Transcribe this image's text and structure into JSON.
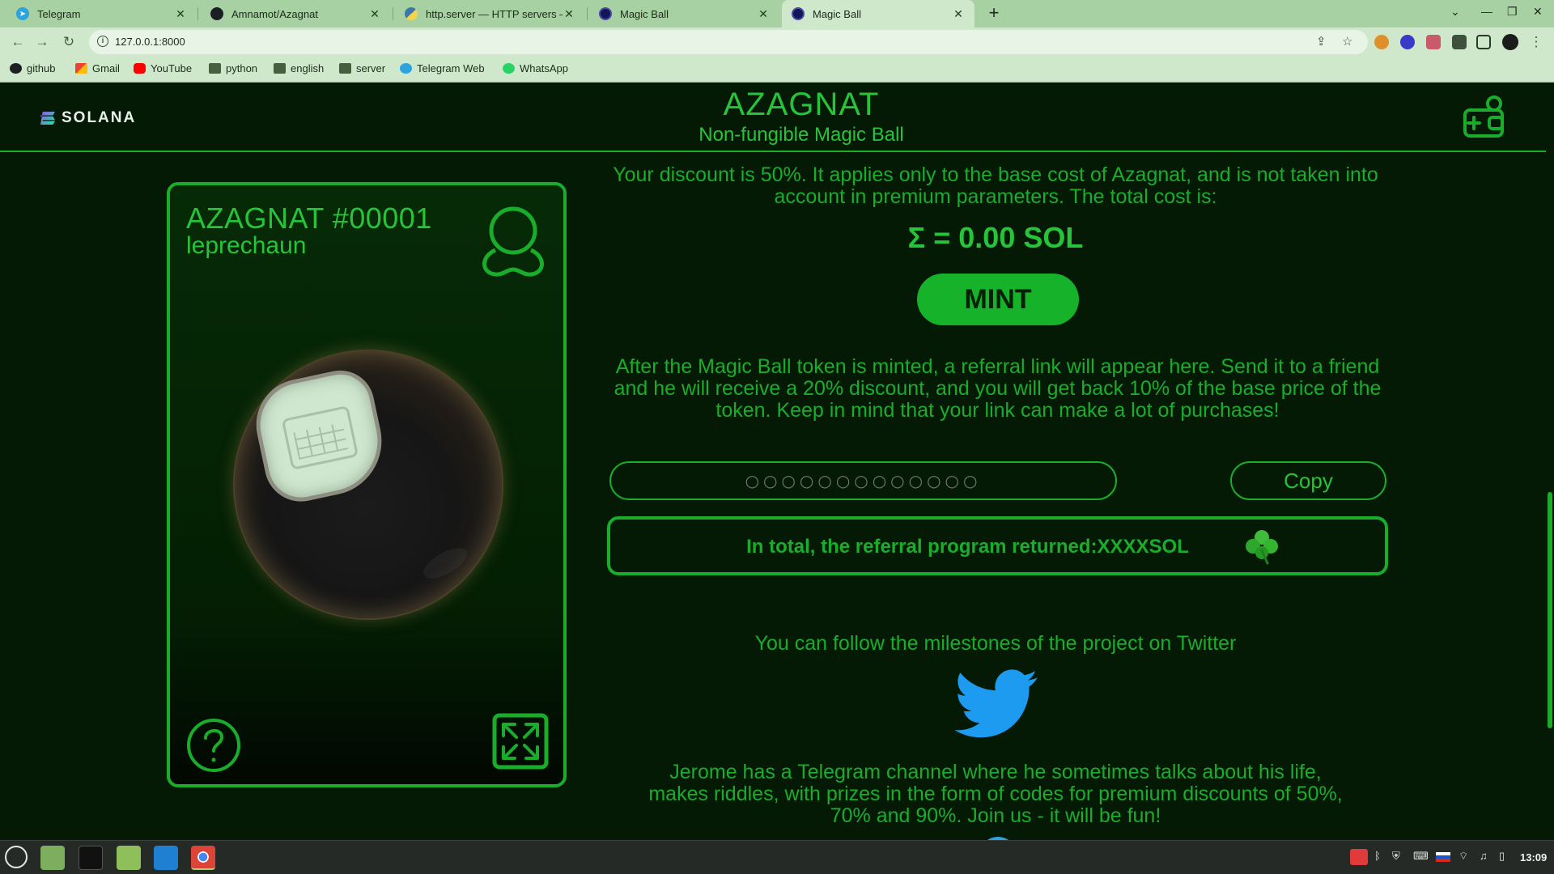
{
  "browser": {
    "tabs": [
      {
        "title": "Telegram",
        "icon": "telegram-icon"
      },
      {
        "title": "Amnamot/Azagnat",
        "icon": "github-icon"
      },
      {
        "title": "http.server — HTTP servers —",
        "icon": "python-icon"
      },
      {
        "title": "Magic Ball",
        "icon": "magic-ball-icon"
      },
      {
        "title": "Magic Ball",
        "icon": "magic-ball-icon",
        "active": true
      }
    ],
    "url": "127.0.0.1:8000",
    "bookmarks": [
      {
        "label": "github",
        "icon": "github-icon"
      },
      {
        "label": "Gmail",
        "icon": "gmail-icon"
      },
      {
        "label": "YouTube",
        "icon": "youtube-icon"
      },
      {
        "label": "python",
        "icon": "folder-icon"
      },
      {
        "label": "english",
        "icon": "folder-icon"
      },
      {
        "label": "server",
        "icon": "folder-icon"
      },
      {
        "label": "Telegram Web",
        "icon": "telegram-icon"
      },
      {
        "label": "WhatsApp",
        "icon": "whatsapp-icon"
      }
    ]
  },
  "header": {
    "logo_text": "SOLANA",
    "title": "AZAGNAT",
    "subtitle": "Non-fungible Magic Ball"
  },
  "card": {
    "title": "AZAGNAT #00001",
    "subtitle": "leprechaun"
  },
  "mint": {
    "discount_text": "Your discount is 50%. It applies only to the base cost of Azagnat, and is not taken into account in premium parameters. The total cost is:",
    "total": "Σ = 0.00 SOL",
    "button_label": "MINT"
  },
  "referral": {
    "info_text": "After the Magic Ball token is minted, a referral link will appear here. Send it to a friend and he will receive a 20% discount, and you will get back 10% of the base price of the token. Keep in mind that your link can make a lot of purchases!",
    "link_placeholder": "○○○○○○○○○○○○○",
    "copy_label": "Copy",
    "returned_text": "In total, the referral program returned:XXXXSOL"
  },
  "social": {
    "twitter_text": "You can follow the milestones of the project on Twitter",
    "telegram_text": "Jerome has a Telegram channel where he sometimes talks about his life, makes riddles, with prizes in the form of codes for premium discounts of 50%, 70% and 90%. Join us - it will be fun!"
  },
  "taskbar": {
    "clock": "13:09"
  },
  "colors": {
    "accent": "#1aad2c",
    "accent_bright": "#27c338",
    "page_bg": "#051a05",
    "mint_button": "#16b32a",
    "twitter_blue": "#1d9bf0"
  }
}
